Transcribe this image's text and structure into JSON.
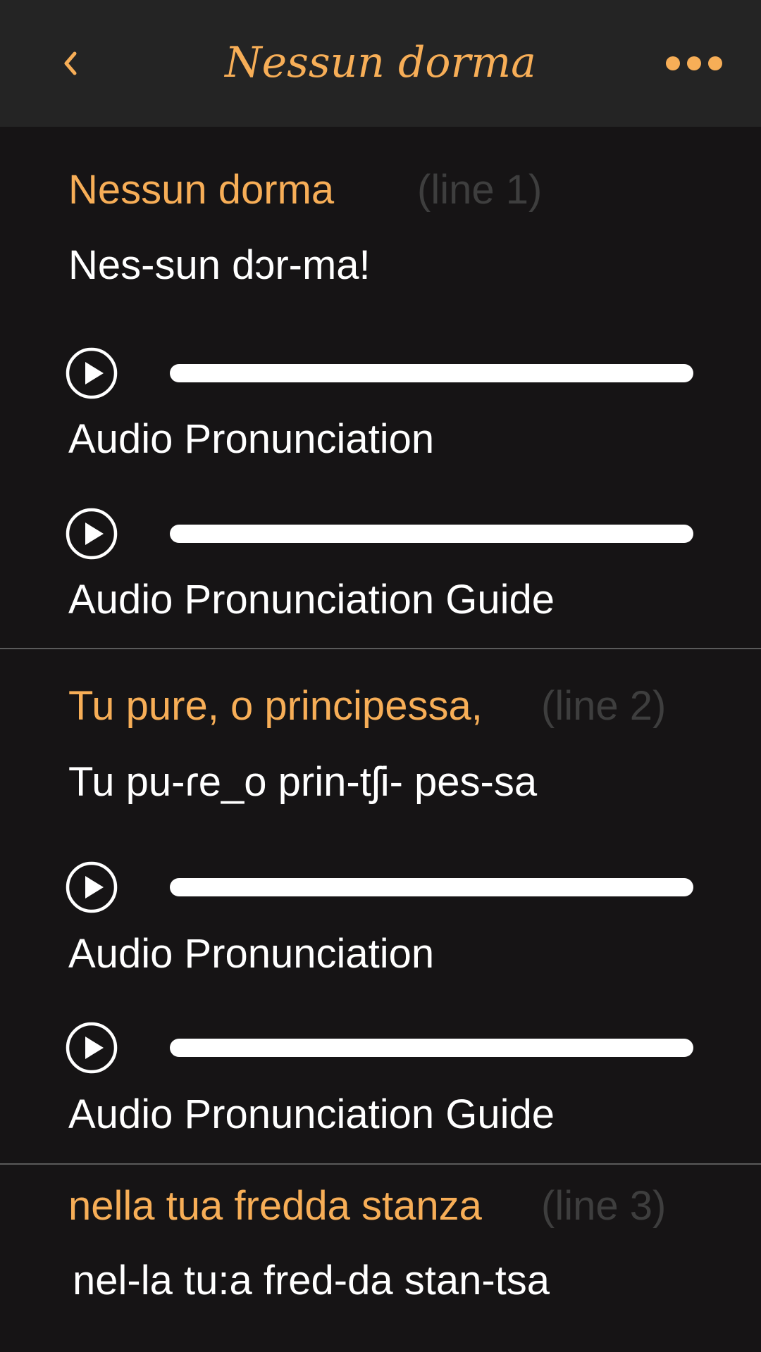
{
  "header": {
    "title": "Nessun dorma",
    "back_icon": "chevron-left-icon",
    "more_icon": "more-horizontal-icon"
  },
  "colors": {
    "accent": "#F7AE57",
    "background": "#161415",
    "header_background": "#242424",
    "muted": "#3e3e3e",
    "text": "#ffffff"
  },
  "lines": [
    {
      "title": "Nessun dorma",
      "line_label": "(line 1)",
      "phonetic": "Nes-sun dɔr-ma!",
      "audio_label": "Audio Pronunciation",
      "guide_label": "Audio Pronunciation Guide"
    },
    {
      "title": "Tu pure, o principessa,",
      "line_label": "(line 2)",
      "phonetic": "Tu pu-ɾe_o prin-tʃi- pes-sa",
      "audio_label": "Audio Pronunciation",
      "guide_label": "Audio Pronunciation Guide"
    },
    {
      "title": "nella tua fredda stanza",
      "line_label": "(line 3)",
      "phonetic": "nel-la tu:a fred-da stan-tsa"
    }
  ]
}
